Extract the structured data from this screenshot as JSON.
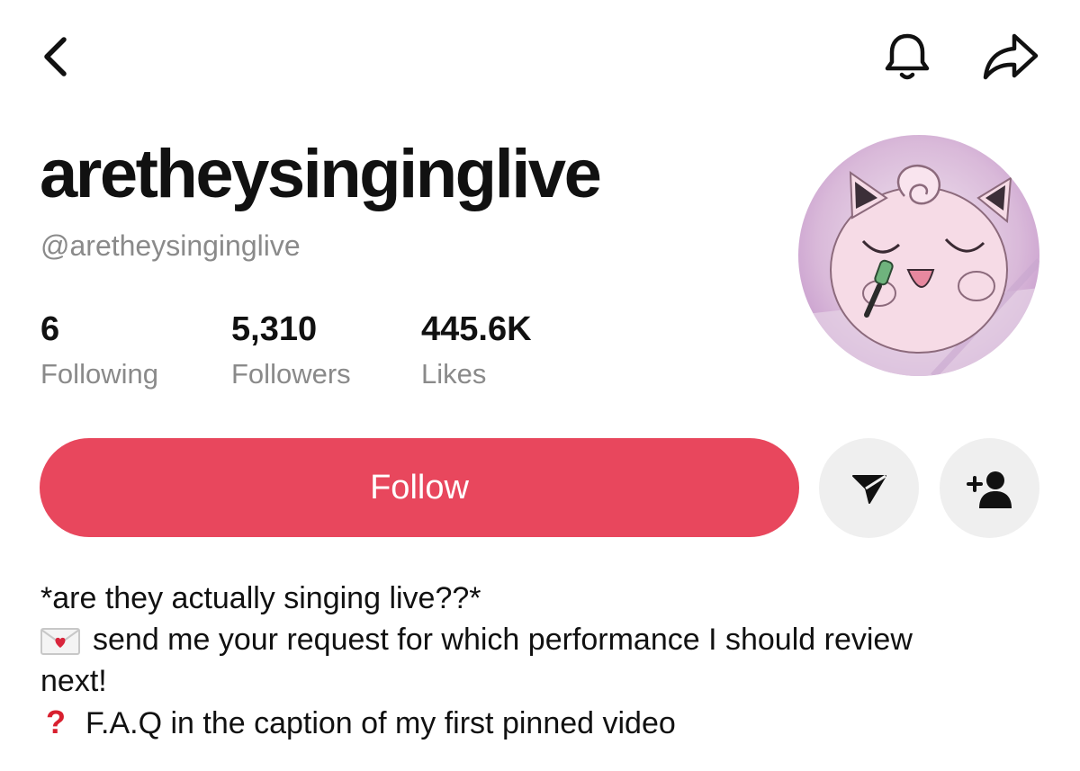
{
  "header": {
    "back_icon": "chevron-left-icon",
    "bell_icon": "bell-icon",
    "share_icon": "share-arrow-icon"
  },
  "profile": {
    "display_name": "aretheysinginglive",
    "handle": "@aretheysinginglive",
    "avatar_icon": "jigglypuff-avatar"
  },
  "stats": [
    {
      "value": "6",
      "label": "Following"
    },
    {
      "value": "5,310",
      "label": "Followers"
    },
    {
      "value": "445.6K",
      "label": "Likes"
    }
  ],
  "actions": {
    "follow_label": "Follow",
    "message_icon": "send-message-icon",
    "add_friend_icon": "add-user-icon"
  },
  "bio": {
    "line1": "*are they actually singing live??*",
    "line2": "send me your request for which performance I should review",
    "line3": "next!",
    "line4": "F.A.Q in the caption of my first pinned video",
    "line2_icon": "love-letter-icon",
    "line4_icon": "red-question-mark-icon"
  },
  "colors": {
    "accent": "#e8475d",
    "secondary_text": "#8a8a8a",
    "button_gray": "#efefef"
  }
}
